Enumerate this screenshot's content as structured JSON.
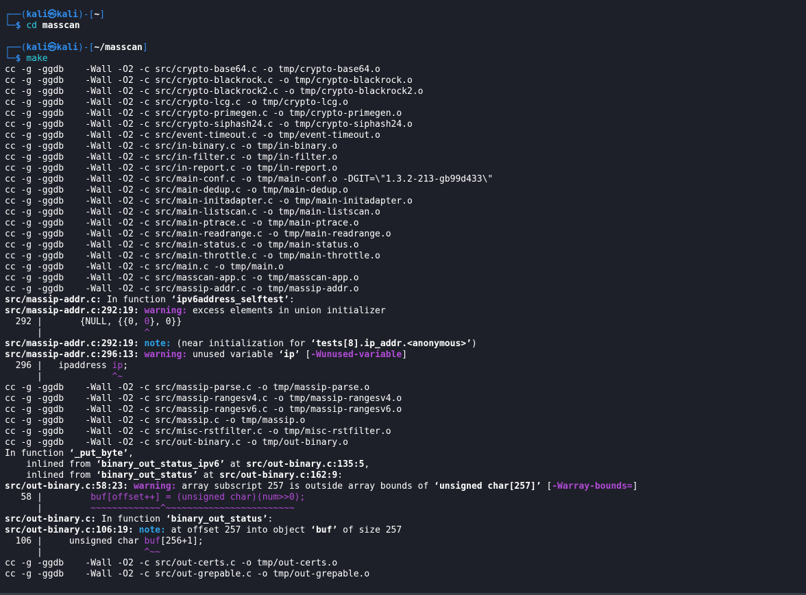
{
  "prompt1": {
    "box_top": "┌──(",
    "user": "kali㉿kali",
    "bracket_mid": ")-[",
    "path": "~",
    "bracket_end": "]",
    "box_bottom": "└─",
    "dollar": "$",
    "cmd": "cd",
    "arg": "masscan"
  },
  "prompt2": {
    "box_top": "┌──(",
    "user": "kali㉿kali",
    "bracket_mid": ")-[",
    "path": "~/masscan",
    "bracket_end": "]",
    "box_bottom": "└─",
    "dollar": "$",
    "cmd": "make"
  },
  "build_lines_1": [
    "cc -g -ggdb    -Wall -O2 -c src/crypto-base64.c -o tmp/crypto-base64.o",
    "cc -g -ggdb    -Wall -O2 -c src/crypto-blackrock.c -o tmp/crypto-blackrock.o",
    "cc -g -ggdb    -Wall -O2 -c src/crypto-blackrock2.c -o tmp/crypto-blackrock2.o",
    "cc -g -ggdb    -Wall -O2 -c src/crypto-lcg.c -o tmp/crypto-lcg.o",
    "cc -g -ggdb    -Wall -O2 -c src/crypto-primegen.c -o tmp/crypto-primegen.o",
    "cc -g -ggdb    -Wall -O2 -c src/crypto-siphash24.c -o tmp/crypto-siphash24.o",
    "cc -g -ggdb    -Wall -O2 -c src/event-timeout.c -o tmp/event-timeout.o",
    "cc -g -ggdb    -Wall -O2 -c src/in-binary.c -o tmp/in-binary.o",
    "cc -g -ggdb    -Wall -O2 -c src/in-filter.c -o tmp/in-filter.o",
    "cc -g -ggdb    -Wall -O2 -c src/in-report.c -o tmp/in-report.o",
    "cc -g -ggdb    -Wall -O2 -c src/main-conf.c -o tmp/main-conf.o -DGIT=\\\"1.3.2-213-gb99d433\\\"",
    "cc -g -ggdb    -Wall -O2 -c src/main-dedup.c -o tmp/main-dedup.o",
    "cc -g -ggdb    -Wall -O2 -c src/main-initadapter.c -o tmp/main-initadapter.o",
    "cc -g -ggdb    -Wall -O2 -c src/main-listscan.c -o tmp/main-listscan.o",
    "cc -g -ggdb    -Wall -O2 -c src/main-ptrace.c -o tmp/main-ptrace.o",
    "cc -g -ggdb    -Wall -O2 -c src/main-readrange.c -o tmp/main-readrange.o",
    "cc -g -ggdb    -Wall -O2 -c src/main-status.c -o tmp/main-status.o",
    "cc -g -ggdb    -Wall -O2 -c src/main-throttle.c -o tmp/main-throttle.o",
    "cc -g -ggdb    -Wall -O2 -c src/main.c -o tmp/main.o",
    "cc -g -ggdb    -Wall -O2 -c src/masscan-app.c -o tmp/masscan-app.o",
    "cc -g -ggdb    -Wall -O2 -c src/massip-addr.c -o tmp/massip-addr.o"
  ],
  "diag1": {
    "file_fn": "src/massip-addr.c:",
    "in_function": " In function ",
    "fn_name": "‘ipv6address_selftest’",
    "colon": ":",
    "w1_loc": "src/massip-addr.c:292:19:",
    "w1_label": "warning:",
    "w1_msg": " excess elements in union initializer",
    "w1_gutter": "  292 |       ",
    "w1_code_a": "{NULL, {{0, ",
    "w1_code_hl": "0",
    "w1_code_b": "}, 0}}",
    "w1_caret_gutter": "      |                   ",
    "w1_caret": "^",
    "n1_loc": "src/massip-addr.c:292:19:",
    "n1_label": "note:",
    "n1_msg_a": " (near initialization for ",
    "n1_msg_b": "‘tests[8].ip_addr.<anonymous>’",
    "n1_msg_c": ")",
    "w2_loc": "src/massip-addr.c:296:13:",
    "w2_label": "warning:",
    "w2_msg_a": " unused variable ",
    "w2_msg_b": "‘ip’",
    "w2_msg_c": " [",
    "w2_flag": "-Wunused-variable",
    "w2_msg_d": "]",
    "w2_gutter": "  296 |   ipaddress ",
    "w2_code_hl": "ip",
    "w2_code_b": ";",
    "w2_caret_gutter": "      |             ",
    "w2_caret": "^~"
  },
  "build_lines_2": [
    "cc -g -ggdb    -Wall -O2 -c src/massip-parse.c -o tmp/massip-parse.o",
    "cc -g -ggdb    -Wall -O2 -c src/massip-rangesv4.c -o tmp/massip-rangesv4.o",
    "cc -g -ggdb    -Wall -O2 -c src/massip-rangesv6.c -o tmp/massip-rangesv6.o",
    "cc -g -ggdb    -Wall -O2 -c src/massip.c -o tmp/massip.o",
    "cc -g -ggdb    -Wall -O2 -c src/misc-rstfilter.c -o tmp/misc-rstfilter.o",
    "cc -g -ggdb    -Wall -O2 -c src/out-binary.c -o tmp/out-binary.o"
  ],
  "diag2": {
    "in_function": "In function ",
    "fn_name": "‘_put_byte’",
    "fn_comma": ",",
    "inl1_a": "    inlined from ",
    "inl1_fn": "‘binary_out_status_ipv6’",
    "inl1_at": " at ",
    "inl1_loc": "src/out-binary.c:135:5",
    "inl1_end": ",",
    "inl2_a": "    inlined from ",
    "inl2_fn": "‘binary_out_status’",
    "inl2_at": " at ",
    "inl2_loc": "src/out-binary.c:162:9",
    "inl2_end": ":",
    "w_loc": "src/out-binary.c:58:23:",
    "w_label": "warning:",
    "w_msg_a": " array subscript 257 is outside array bounds of ",
    "w_msg_b": "‘unsigned char[257]’",
    "w_msg_c": " [",
    "w_flag": "-Warray-bounds=",
    "w_msg_d": "]",
    "w_gutter": "   58 |         ",
    "w_code_hl": "buf[offset++] = (unsigned char)(num>>0);",
    "w_caret_gutter": "      |         ",
    "w_caret": "~~~~~~~~~~~~~^~~~~~~~~~~~~~~~~~~~~~~~~",
    "f_loc": "src/out-binary.c:",
    "f_in": " In function ",
    "f_name": "‘binary_out_status’",
    "f_colon": ":",
    "n_loc": "src/out-binary.c:106:19:",
    "n_label": "note:",
    "n_msg_a": " at offset 257 into object ",
    "n_msg_b": "‘buf’",
    "n_msg_c": " of size 257",
    "n_gutter": "  106 |     unsigned char ",
    "n_code_hl": "buf",
    "n_code_b": "[256+1];",
    "n_caret_gutter": "      |                   ",
    "n_caret": "^~~"
  },
  "build_lines_3": [
    "cc -g -ggdb    -Wall -O2 -c src/out-certs.c -o tmp/out-certs.o",
    "cc -g -ggdb    -Wall -O2 -c src/out-grepable.c -o tmp/out-grepable.o"
  ],
  "colors": {
    "background": "#1e2029",
    "prompt_blue": "#2f8ff0",
    "command_cyan": "#2fd1e0",
    "warning_magenta": "#b14bd6",
    "note_blue": "#2fa5e8"
  }
}
